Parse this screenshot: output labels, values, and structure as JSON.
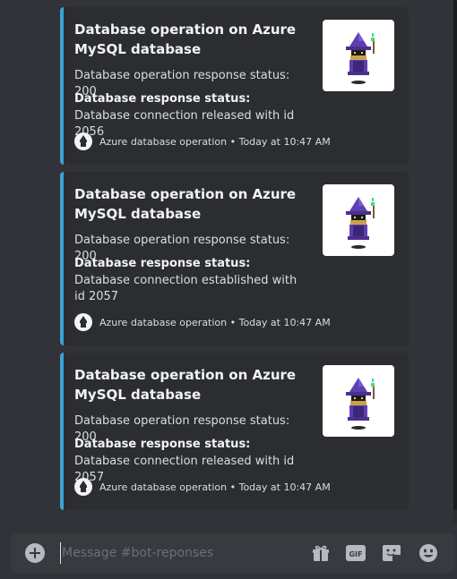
{
  "embeds": [
    {
      "title": "Database operation on Azure MySQL database",
      "description": "Database operation response status: 200",
      "field_name": "Database response status:",
      "field_value": "Database connection released with id 2056",
      "footer": "Azure database operation • Today at 10:47 AM"
    },
    {
      "title": "Database operation on Azure MySQL database",
      "description": "Database operation response status: 200",
      "field_name": "Database response status:",
      "field_value": "Database connection established with id 2057",
      "footer": "Azure database operation • Today at 10:47 AM"
    },
    {
      "title": "Database operation on Azure MySQL database",
      "description": "Database operation response status: 200",
      "field_name": "Database response status:",
      "field_value": "Database connection released with id 2057",
      "footer": "Azure database operation • Today at 10:47 AM"
    }
  ],
  "composer": {
    "placeholder": "Message #bot-reponses",
    "gif_label": "GIF"
  },
  "icons": {
    "attach": "plus-circle-icon",
    "gift": "gift-icon",
    "gif": "gif-icon",
    "sticker": "sticker-icon",
    "emoji": "emoji-icon"
  },
  "colors": {
    "background": "#313338",
    "embed_background": "#2b2d31",
    "embed_accent": "#3ba2d3",
    "composer_background": "#383a40"
  }
}
